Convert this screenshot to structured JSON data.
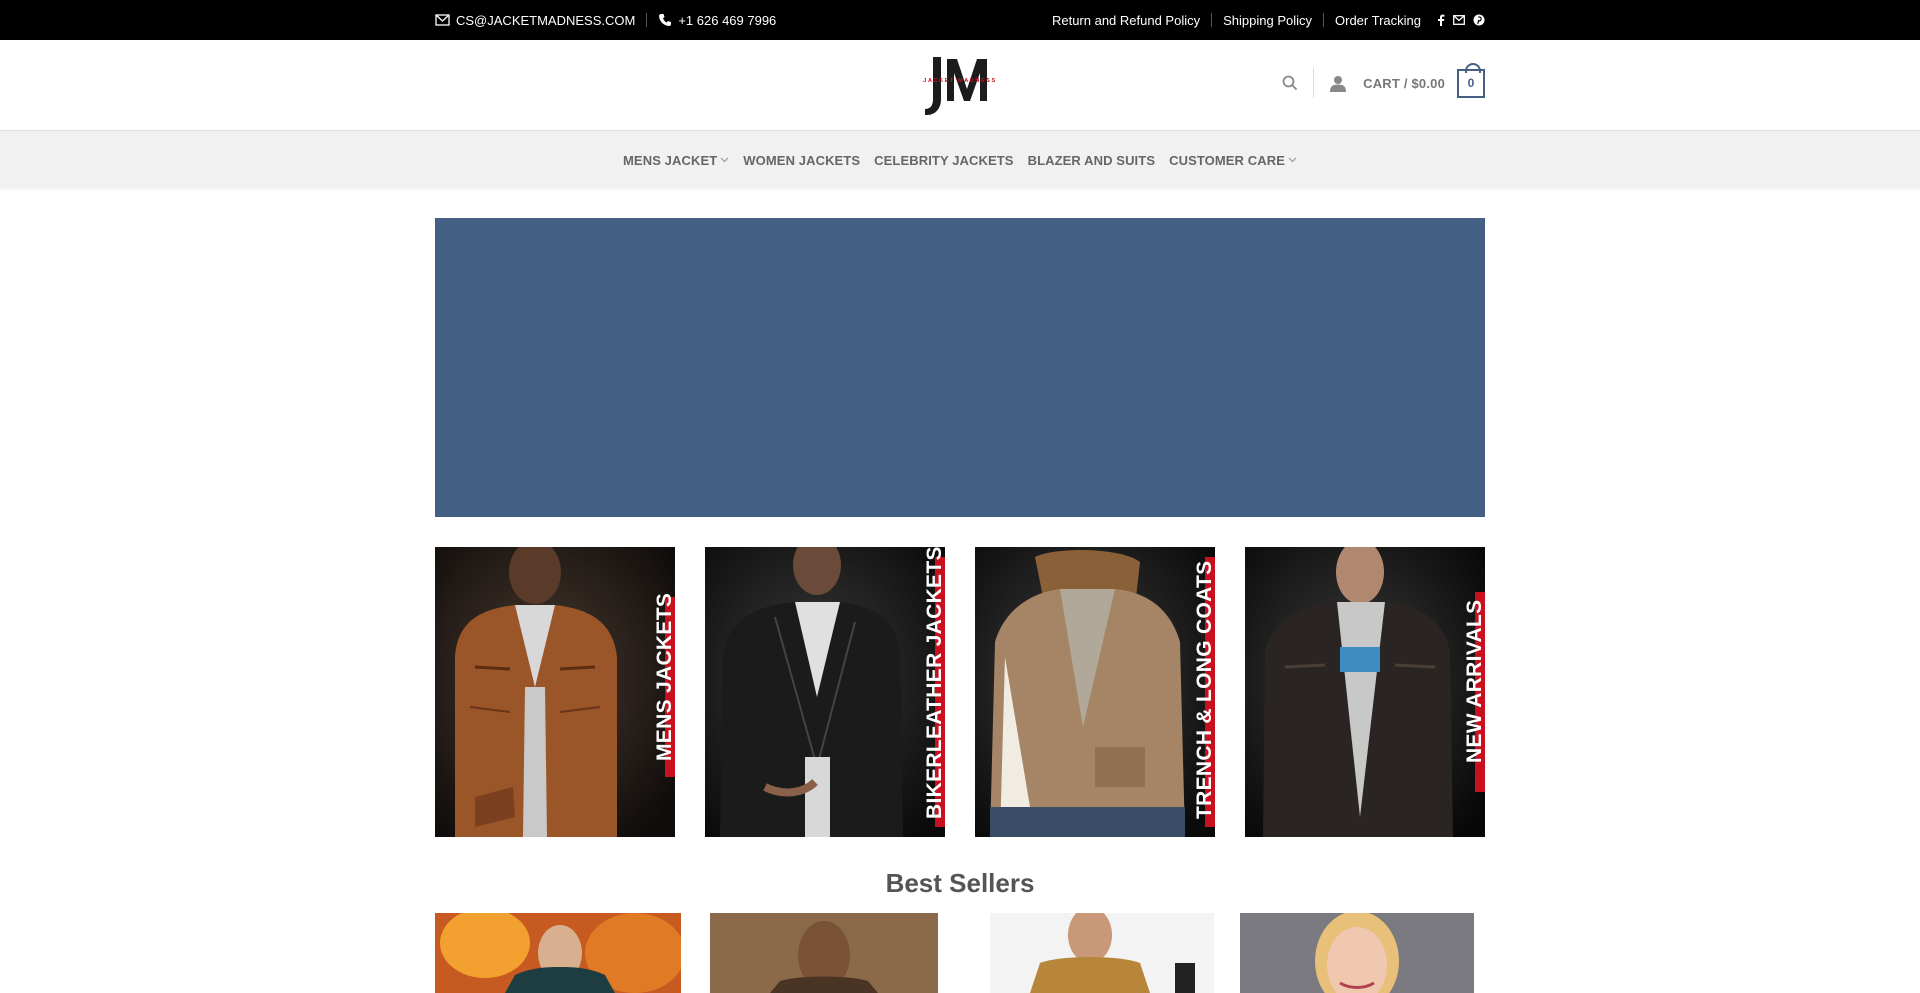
{
  "topbar": {
    "email": "CS@JACKETMADNESS.COM",
    "phone": "+1 626 469 7996",
    "links": [
      "Return and Refund Policy",
      "Shipping Policy",
      "Order Tracking"
    ],
    "social_icons": [
      "facebook-icon",
      "mail-icon",
      "pinterest-icon"
    ]
  },
  "header": {
    "logo_text": "JM",
    "logo_subtext": "JACKET MADNESS",
    "cart_label": "CART / $0.00",
    "cart_count": "0",
    "icons": [
      "search-icon",
      "user-icon"
    ]
  },
  "nav": {
    "items": [
      {
        "label": "MENS JACKET",
        "dropdown": true
      },
      {
        "label": "WOMEN JACKETS",
        "dropdown": false
      },
      {
        "label": "CELEBRITY JACKETS",
        "dropdown": false
      },
      {
        "label": "BLAZER AND SUITS",
        "dropdown": false
      },
      {
        "label": "CUSTOMER CARE",
        "dropdown": true
      }
    ]
  },
  "categories": [
    {
      "label": "MENS JACKETS"
    },
    {
      "label": "BIKERLEATHER JACKETS"
    },
    {
      "label": "TRENCH & LONG COATS"
    },
    {
      "label": "NEW ARRIVALS"
    }
  ],
  "best_sellers": {
    "title": "Best Sellers"
  },
  "colors": {
    "accent": "#446084",
    "topbar": "#000000",
    "strip": "#c8101e"
  }
}
